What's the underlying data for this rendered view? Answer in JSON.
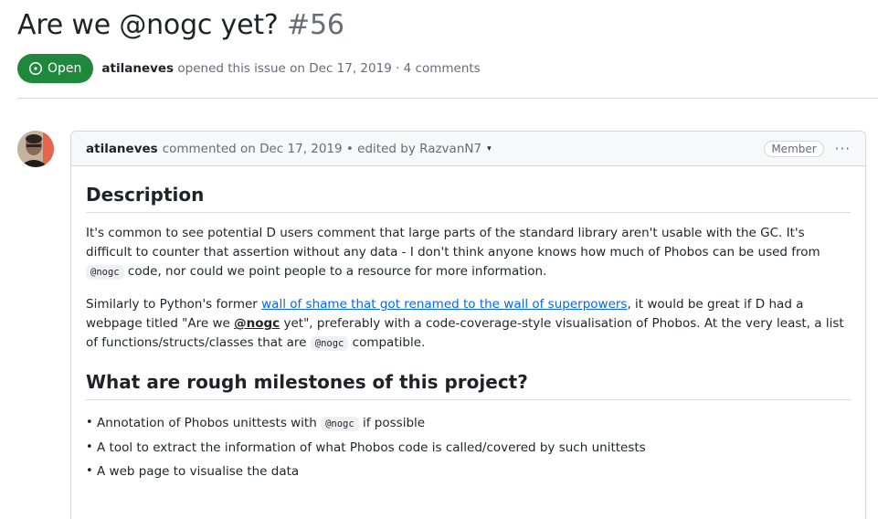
{
  "issue": {
    "title": "Are we @nogc yet?",
    "number": "#56",
    "state_label": "Open",
    "author": "atilaneves",
    "opened_text": "opened this issue on Dec 17, 2019 · 4 comments"
  },
  "comment": {
    "author": "atilaneves",
    "meta_text": "commented on Dec 17, 2019 • edited by RazvanN7",
    "edit_caret": "▾",
    "role_badge": "Member",
    "menu_label": "···",
    "h_description": "Description",
    "p1_text": "It's common to see potential D users comment that large parts of the standard library aren't usable with the GC. It's difficult to counter that assertion without any data - I don't think anyone knows how much of Phobos can be used from",
    "p1_code": "@nogc",
    "p1_tail": "code, nor could we point people to a resource for more information.",
    "p2_text": "Similarly to Python's former",
    "p2_link": "wall of shame that got renamed to the wall of superpowers",
    "p2_mid": ", it would be great if D had a webpage titled \"Are we",
    "p2_mention": "@nogc",
    "p2_mid2": "yet\", preferably with a code-coverage-style visualisation of Phobos. At the very least, a list of functions/structs/classes that are",
    "p2_code": "@nogc",
    "p2_tail": "compatible.",
    "h_milestones": "What are rough milestones of this project?",
    "items": [
      {
        "text": "Annotation of Phobos unittests with",
        "code": "@nogc",
        "tail": "if possible"
      },
      {
        "text": "A tool to extract the information of what Phobos code is called/covered by such unittests"
      },
      {
        "text": "A web page to visualise the data"
      }
    ]
  },
  "colors": {
    "open_green": "#1f883d",
    "link_blue": "#0969da",
    "muted": "#656d76"
  },
  "icons": {
    "state": "issue-opened-icon",
    "avatar": "user-avatar",
    "menu": "kebab-horizontal-icon"
  }
}
